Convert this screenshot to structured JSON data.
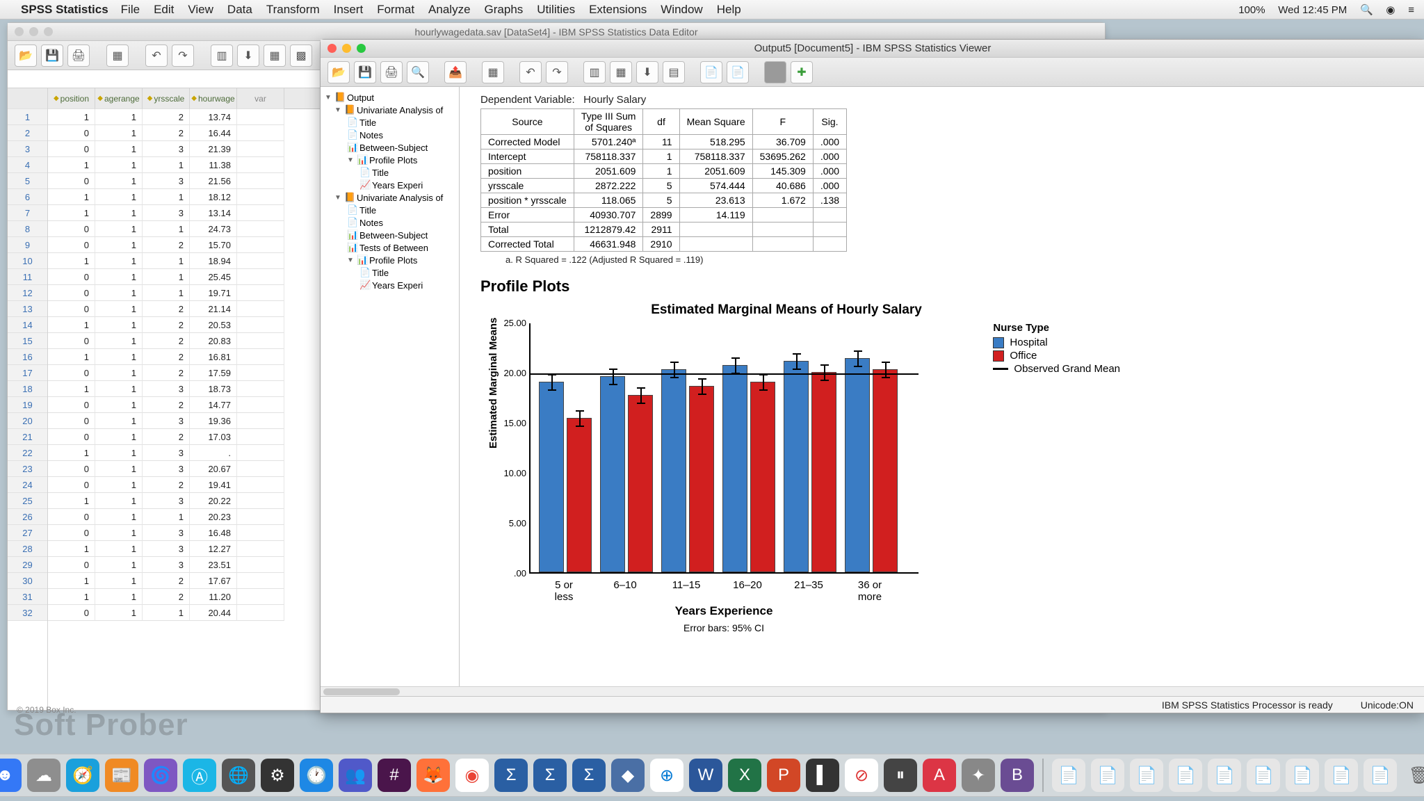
{
  "menubar": {
    "app": "SPSS Statistics",
    "items": [
      "File",
      "Edit",
      "View",
      "Data",
      "Transform",
      "Insert",
      "Format",
      "Analyze",
      "Graphs",
      "Utilities",
      "Extensions",
      "Window",
      "Help"
    ],
    "battery": "100%",
    "clock": "Wed 12:45 PM"
  },
  "data_window": {
    "title": "hourlywagedata.sav [DataSet4] - IBM SPSS Statistics Data Editor",
    "columns": [
      "position",
      "agerange",
      "yrsscale",
      "hourwage",
      "var"
    ],
    "rows": [
      [
        1,
        1,
        2,
        "13.74"
      ],
      [
        0,
        1,
        2,
        "16.44"
      ],
      [
        0,
        1,
        3,
        "21.39"
      ],
      [
        1,
        1,
        1,
        "11.38"
      ],
      [
        0,
        1,
        3,
        "21.56"
      ],
      [
        1,
        1,
        1,
        "18.12"
      ],
      [
        1,
        1,
        3,
        "13.14"
      ],
      [
        0,
        1,
        1,
        "24.73"
      ],
      [
        0,
        1,
        2,
        "15.70"
      ],
      [
        1,
        1,
        1,
        "18.94"
      ],
      [
        0,
        1,
        1,
        "25.45"
      ],
      [
        0,
        1,
        1,
        "19.71"
      ],
      [
        0,
        1,
        2,
        "21.14"
      ],
      [
        1,
        1,
        2,
        "20.53"
      ],
      [
        0,
        1,
        2,
        "20.83"
      ],
      [
        1,
        1,
        2,
        "16.81"
      ],
      [
        0,
        1,
        2,
        "17.59"
      ],
      [
        1,
        1,
        3,
        "18.73"
      ],
      [
        0,
        1,
        2,
        "14.77"
      ],
      [
        0,
        1,
        3,
        "19.36"
      ],
      [
        0,
        1,
        2,
        "17.03"
      ],
      [
        1,
        1,
        3,
        "."
      ],
      [
        0,
        1,
        3,
        "20.67"
      ],
      [
        0,
        1,
        2,
        "19.41"
      ],
      [
        1,
        1,
        3,
        "20.22"
      ],
      [
        0,
        1,
        1,
        "20.23"
      ],
      [
        0,
        1,
        3,
        "16.48"
      ],
      [
        1,
        1,
        3,
        "12.27"
      ],
      [
        0,
        1,
        3,
        "23.51"
      ],
      [
        1,
        1,
        2,
        "17.67"
      ],
      [
        1,
        1,
        2,
        "11.20"
      ],
      [
        0,
        1,
        1,
        "20.44"
      ]
    ]
  },
  "output_window": {
    "title": "Output5 [Document5] - IBM SPSS Statistics Viewer",
    "outline": {
      "root": "Output",
      "g1": "Univariate Analysis of",
      "title": "Title",
      "notes": "Notes",
      "bsf": "Between-Subject",
      "pp": "Profile Plots",
      "ye": "Years Experi",
      "g2": "Univariate Analysis of",
      "tob": "Tests of Between"
    },
    "anova": {
      "dv_label": "Dependent Variable:",
      "dv": "Hourly Salary",
      "headers": [
        "Source",
        "Type III Sum of Squares",
        "df",
        "Mean Square",
        "F",
        "Sig."
      ],
      "rows": [
        [
          "Corrected Model",
          "5701.240ª",
          "11",
          "518.295",
          "36.709",
          ".000"
        ],
        [
          "Intercept",
          "758118.337",
          "1",
          "758118.337",
          "53695.262",
          ".000"
        ],
        [
          "position",
          "2051.609",
          "1",
          "2051.609",
          "145.309",
          ".000"
        ],
        [
          "yrsscale",
          "2872.222",
          "5",
          "574.444",
          "40.686",
          ".000"
        ],
        [
          "position * yrsscale",
          "118.065",
          "5",
          "23.613",
          "1.672",
          ".138"
        ],
        [
          "Error",
          "40930.707",
          "2899",
          "14.119",
          "",
          ""
        ],
        [
          "Total",
          "1212879.42",
          "2911",
          "",
          "",
          ""
        ],
        [
          "Corrected Total",
          "46631.948",
          "2910",
          "",
          "",
          ""
        ]
      ],
      "footnote": "a. R Squared = .122 (Adjusted R Squared = .119)"
    },
    "profile_plots_heading": "Profile Plots",
    "status": "IBM SPSS Statistics Processor is ready",
    "unicode": "Unicode:ON"
  },
  "chart_data": {
    "type": "bar",
    "title": "Estimated Marginal Means of Hourly Salary",
    "xlabel": "Years Experience",
    "ylabel": "Estimated Marginal Means",
    "categories": [
      "5 or less",
      "6–10",
      "11–15",
      "16–20",
      "21–35",
      "36 or more"
    ],
    "series": [
      {
        "name": "Hospital",
        "color": "#3a7cc4",
        "values": [
          19.0,
          19.6,
          20.3,
          20.7,
          21.1,
          21.4
        ]
      },
      {
        "name": "Office",
        "color": "#d11f1f",
        "values": [
          15.4,
          17.7,
          18.6,
          19.0,
          20.0,
          20.3
        ]
      }
    ],
    "grand_mean": 20.0,
    "ylim": [
      0,
      25
    ],
    "yticks": [
      ".00",
      "5.00",
      "10.00",
      "15.00",
      "20.00",
      "25.00"
    ],
    "legend_title": "Nurse Type",
    "legend_extra": "Observed Grand Mean",
    "error_bars_label": "Error bars: 95% CI"
  },
  "watermark": "Soft Prober",
  "copyright": "© 2019 Box Inc."
}
